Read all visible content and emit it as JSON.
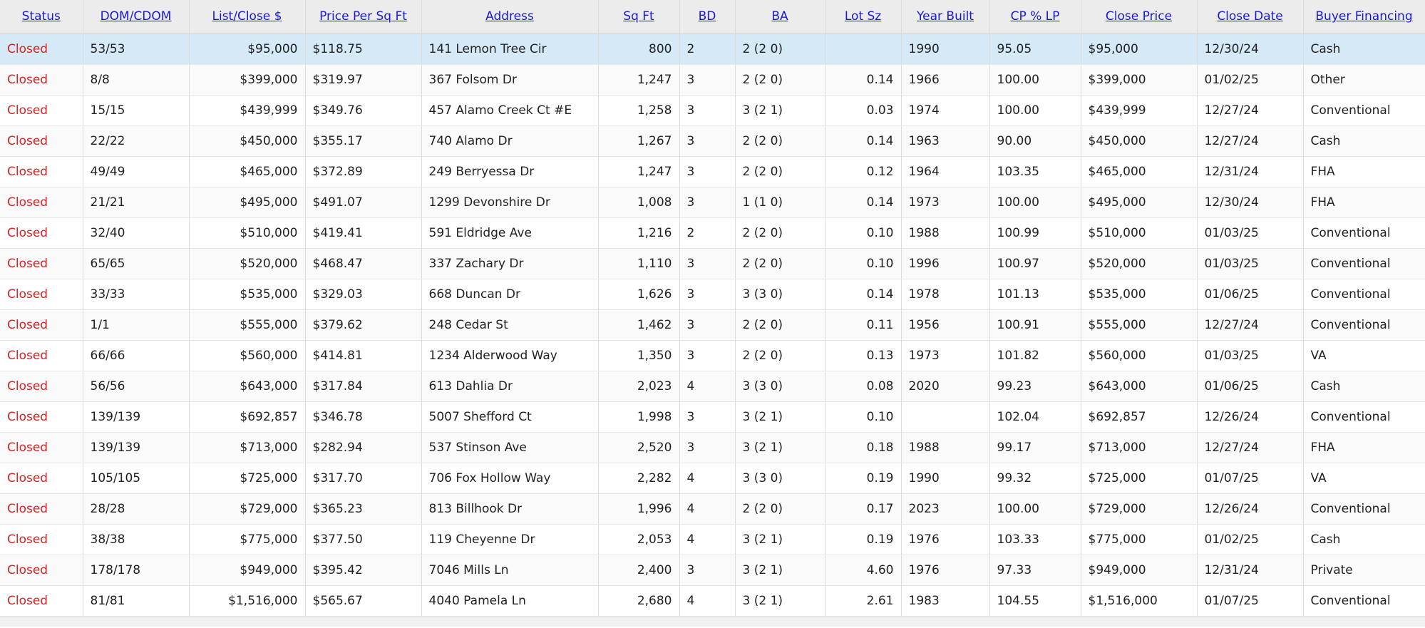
{
  "columns": [
    "Status",
    "DOM/CDOM",
    "List/Close $",
    "Price Per Sq Ft",
    "Address",
    "Sq Ft",
    "BD",
    "BA",
    "Lot Sz",
    "Year Built",
    "CP % LP",
    "Close Price",
    "Close Date",
    "Buyer Financing"
  ],
  "rows": [
    [
      "Closed",
      "53/53",
      "$95,000",
      "$118.75",
      "141 Lemon Tree Cir",
      "800",
      "2",
      "2 (2 0)",
      "",
      "1990",
      "95.05",
      "$95,000",
      "12/30/24",
      "Cash"
    ],
    [
      "Closed",
      "8/8",
      "$399,000",
      "$319.97",
      "367 Folsom Dr",
      "1,247",
      "3",
      "2 (2 0)",
      "0.14",
      "1966",
      "100.00",
      "$399,000",
      "01/02/25",
      "Other"
    ],
    [
      "Closed",
      "15/15",
      "$439,999",
      "$349.76",
      "457 Alamo Creek Ct #E",
      "1,258",
      "3",
      "3 (2 1)",
      "0.03",
      "1974",
      "100.00",
      "$439,999",
      "12/27/24",
      "Conventional"
    ],
    [
      "Closed",
      "22/22",
      "$450,000",
      "$355.17",
      "740 Alamo Dr",
      "1,267",
      "3",
      "2 (2 0)",
      "0.14",
      "1963",
      "90.00",
      "$450,000",
      "12/27/24",
      "Cash"
    ],
    [
      "Closed",
      "49/49",
      "$465,000",
      "$372.89",
      "249 Berryessa Dr",
      "1,247",
      "3",
      "2 (2 0)",
      "0.12",
      "1964",
      "103.35",
      "$465,000",
      "12/31/24",
      "FHA"
    ],
    [
      "Closed",
      "21/21",
      "$495,000",
      "$491.07",
      "1299 Devonshire Dr",
      "1,008",
      "3",
      "1 (1 0)",
      "0.14",
      "1973",
      "100.00",
      "$495,000",
      "12/30/24",
      "FHA"
    ],
    [
      "Closed",
      "32/40",
      "$510,000",
      "$419.41",
      "591 Eldridge Ave",
      "1,216",
      "2",
      "2 (2 0)",
      "0.10",
      "1988",
      "100.99",
      "$510,000",
      "01/03/25",
      "Conventional"
    ],
    [
      "Closed",
      "65/65",
      "$520,000",
      "$468.47",
      "337 Zachary Dr",
      "1,110",
      "3",
      "2 (2 0)",
      "0.10",
      "1996",
      "100.97",
      "$520,000",
      "01/03/25",
      "Conventional"
    ],
    [
      "Closed",
      "33/33",
      "$535,000",
      "$329.03",
      "668 Duncan Dr",
      "1,626",
      "3",
      "3 (3 0)",
      "0.14",
      "1978",
      "101.13",
      "$535,000",
      "01/06/25",
      "Conventional"
    ],
    [
      "Closed",
      "1/1",
      "$555,000",
      "$379.62",
      "248 Cedar St",
      "1,462",
      "3",
      "2 (2 0)",
      "0.11",
      "1956",
      "100.91",
      "$555,000",
      "12/27/24",
      "Conventional"
    ],
    [
      "Closed",
      "66/66",
      "$560,000",
      "$414.81",
      "1234 Alderwood Way",
      "1,350",
      "3",
      "2 (2 0)",
      "0.13",
      "1973",
      "101.82",
      "$560,000",
      "01/03/25",
      "VA"
    ],
    [
      "Closed",
      "56/56",
      "$643,000",
      "$317.84",
      "613 Dahlia Dr",
      "2,023",
      "4",
      "3 (3 0)",
      "0.08",
      "2020",
      "99.23",
      "$643,000",
      "01/06/25",
      "Cash"
    ],
    [
      "Closed",
      "139/139",
      "$692,857",
      "$346.78",
      "5007 Shefford Ct",
      "1,998",
      "3",
      "3 (2 1)",
      "0.10",
      "",
      "102.04",
      "$692,857",
      "12/26/24",
      "Conventional"
    ],
    [
      "Closed",
      "139/139",
      "$713,000",
      "$282.94",
      "537 Stinson Ave",
      "2,520",
      "3",
      "3 (2 1)",
      "0.18",
      "1988",
      "99.17",
      "$713,000",
      "12/27/24",
      "FHA"
    ],
    [
      "Closed",
      "105/105",
      "$725,000",
      "$317.70",
      "706 Fox Hollow Way",
      "2,282",
      "4",
      "3 (3 0)",
      "0.19",
      "1990",
      "99.32",
      "$725,000",
      "01/07/25",
      "VA"
    ],
    [
      "Closed",
      "28/28",
      "$729,000",
      "$365.23",
      "813 Billhook Dr",
      "1,996",
      "4",
      "2 (2 0)",
      "0.17",
      "2023",
      "100.00",
      "$729,000",
      "12/26/24",
      "Conventional"
    ],
    [
      "Closed",
      "38/38",
      "$775,000",
      "$377.50",
      "119 Cheyenne Dr",
      "2,053",
      "4",
      "3 (2 1)",
      "0.19",
      "1976",
      "103.33",
      "$775,000",
      "01/02/25",
      "Cash"
    ],
    [
      "Closed",
      "178/178",
      "$949,000",
      "$395.42",
      "7046 Mills Ln",
      "2,400",
      "3",
      "3 (2 1)",
      "4.60",
      "1976",
      "97.33",
      "$949,000",
      "12/31/24",
      "Private"
    ],
    [
      "Closed",
      "81/81",
      "$1,516,000",
      "$565.67",
      "4040 Pamela Ln",
      "2,680",
      "4",
      "3 (2 1)",
      "2.61",
      "1983",
      "104.55",
      "$1,516,000",
      "01/07/25",
      "Conventional"
    ]
  ],
  "selected_row": 0,
  "colors": {
    "header_link": "#1a1ad6",
    "status_closed": "#e02020",
    "selected_row_bg": "#d6e9f7"
  }
}
